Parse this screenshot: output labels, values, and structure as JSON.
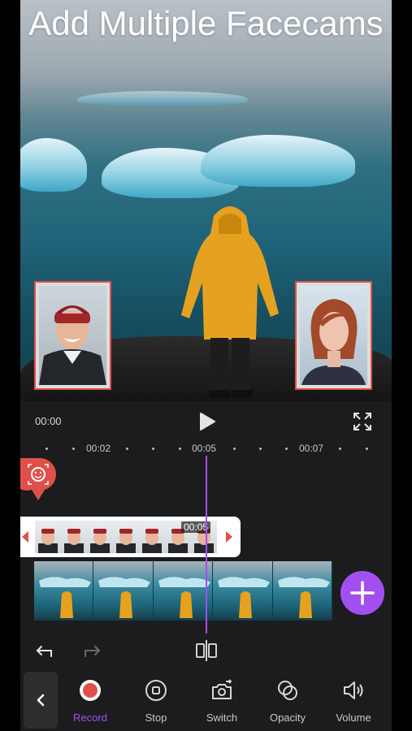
{
  "headline": "Add Multiple Facecams",
  "playback": {
    "current_time": "00:00"
  },
  "ruler": {
    "labels": [
      "00:02",
      "00:05",
      "00:07"
    ]
  },
  "face_track": {
    "time_label": "00:05"
  },
  "toolbar": {
    "tools": [
      {
        "label": "Record",
        "icon": "record-icon",
        "active": true
      },
      {
        "label": "Stop",
        "icon": "stop-icon",
        "active": false
      },
      {
        "label": "Switch",
        "icon": "switch-camera-icon",
        "active": false
      },
      {
        "label": "Opacity",
        "icon": "opacity-icon",
        "active": false
      },
      {
        "label": "Volume",
        "icon": "volume-icon",
        "active": false
      }
    ]
  },
  "colors": {
    "accent": "#a24ff0",
    "record": "#e0504a",
    "facecam_border": "#e0504a"
  }
}
